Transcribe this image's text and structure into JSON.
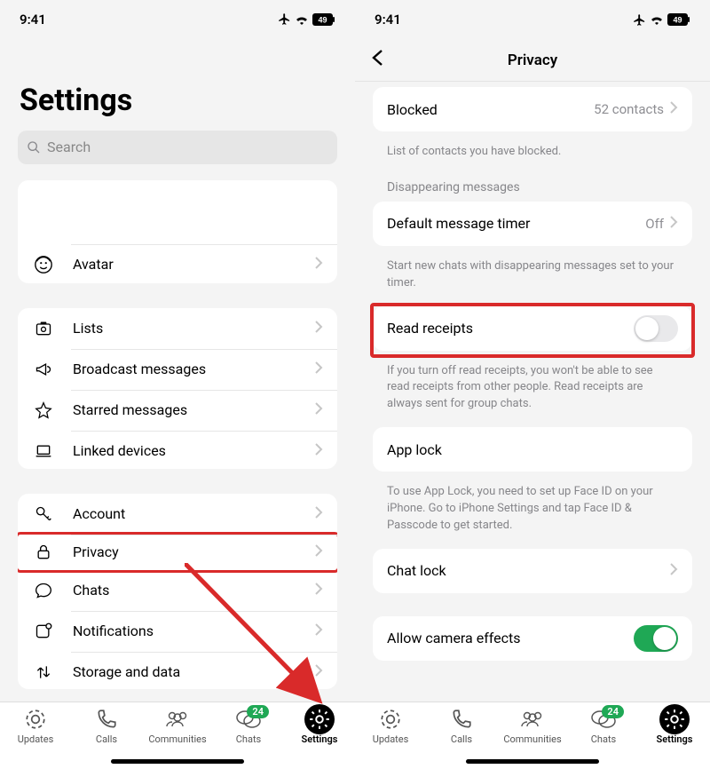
{
  "statusbar": {
    "time": "9:41",
    "battery": "49"
  },
  "left": {
    "title": "Settings",
    "search_placeholder": "Search",
    "rows": {
      "avatar": "Avatar",
      "lists": "Lists",
      "broadcast": "Broadcast messages",
      "starred": "Starred messages",
      "linked": "Linked devices",
      "account": "Account",
      "privacy": "Privacy",
      "chats": "Chats",
      "notifications": "Notifications",
      "storage": "Storage and data"
    }
  },
  "right": {
    "nav_title": "Privacy",
    "blocked": {
      "label": "Blocked",
      "value": "52 contacts"
    },
    "blocked_caption": "List of contacts you have blocked.",
    "disappearing_section": "Disappearing messages",
    "default_timer": {
      "label": "Default message timer",
      "value": "Off"
    },
    "timer_caption": "Start new chats with disappearing messages set to your timer.",
    "read_receipts": {
      "label": "Read receipts",
      "on": false
    },
    "read_receipts_caption": "If you turn off read receipts, you won't be able to see read receipts from other people. Read receipts are always sent for group chats.",
    "app_lock": {
      "label": "App lock"
    },
    "app_lock_caption": "To use App Lock, you need to set up Face ID on your iPhone. Go to iPhone Settings and tap Face ID & Passcode to get started.",
    "chat_lock": {
      "label": "Chat lock"
    },
    "camera_effects": {
      "label": "Allow camera effects",
      "on": true
    }
  },
  "tabs": {
    "updates": "Updates",
    "calls": "Calls",
    "communities": "Communities",
    "chats": "Chats",
    "settings": "Settings",
    "chats_badge": "24"
  }
}
